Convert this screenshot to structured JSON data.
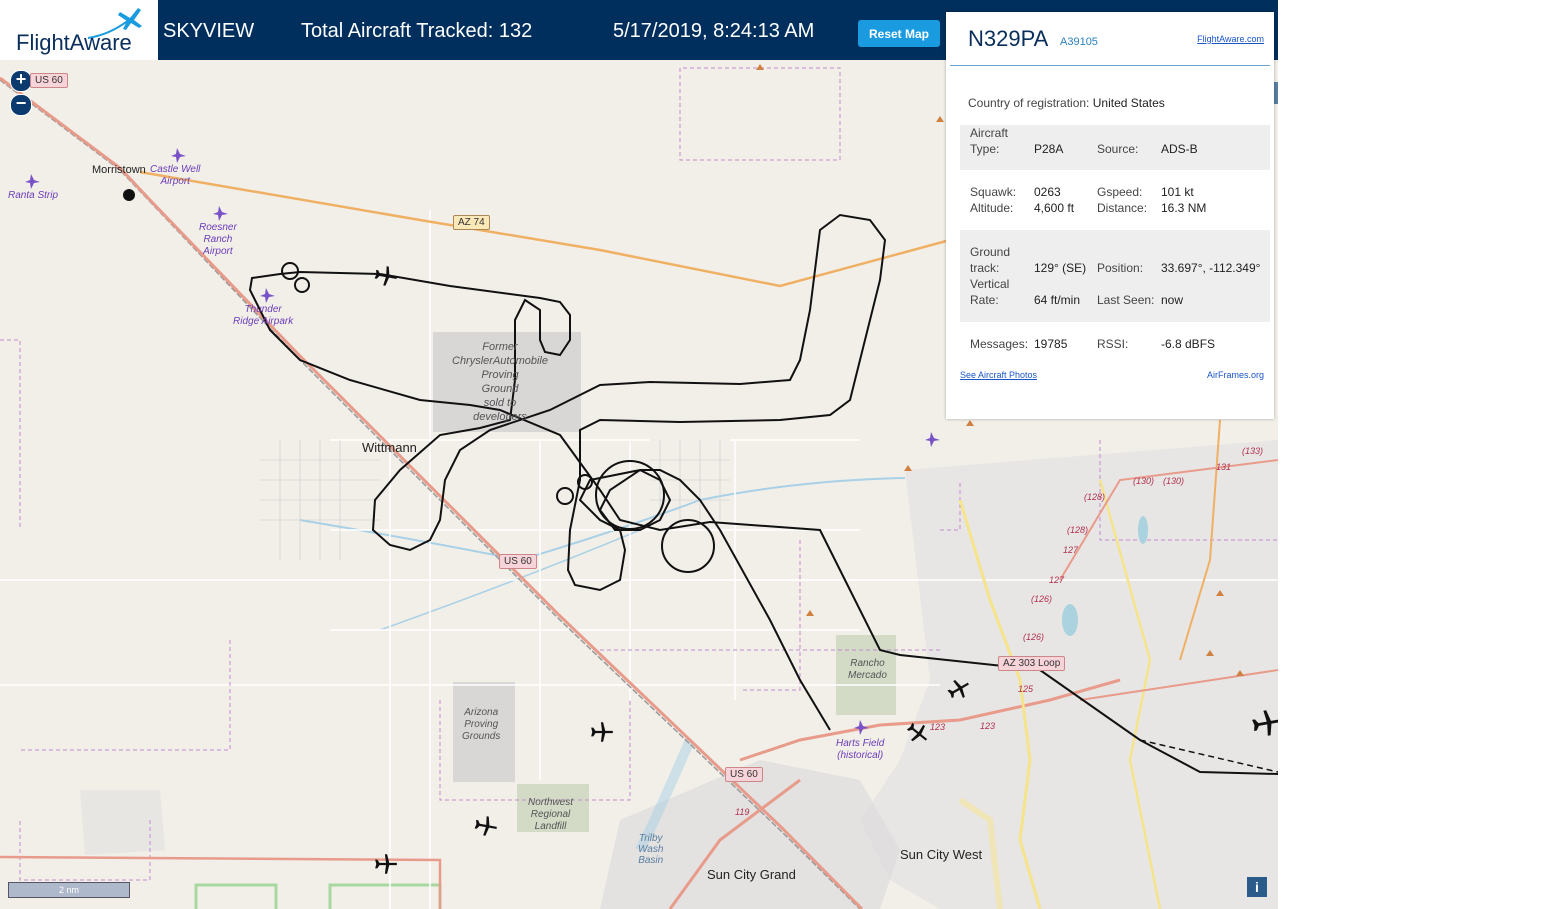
{
  "header": {
    "logo": "FlightAware",
    "title": "SKYVIEW",
    "total_tracked": "Total Aircraft Tracked: 132",
    "datetime": "5/17/2019, 8:24:13 AM",
    "reset_label": "Reset Map"
  },
  "map": {
    "zoom_in": "+",
    "zoom_out": "−",
    "scale": "2 nm",
    "info": "i",
    "labels": {
      "morristown": "Morristown",
      "wittmann": "Wittmann",
      "sun_city_west": "Sun City West",
      "sun_city_grand": "Sun City Grand",
      "ranta": "Ranta Strip",
      "castle_well": "Castle Well\nAirport",
      "roesner": "Roesner\nRanch\nAirport",
      "thunder": "Thunder\nRidge Airpark",
      "harts": "Harts Field\n(historical)",
      "chrysler": "Former\nChryslerAutomobile\nProving\nGround\nsold to\ndevelopers",
      "az_proving": "Arizona\nProving\nGrounds",
      "landfill": "Northwest\nRegional\nLandfill",
      "trilby": "Trilby\nWash\nBasin",
      "rancho": "Rancho\nMercado"
    },
    "shields": {
      "us60_top": "US 60",
      "az74": "AZ 74",
      "us60_mid": "US 60",
      "us60_low": "US 60",
      "az303": "AZ 303 Loop"
    },
    "route_numbers": [
      "(133)",
      "131",
      "(130)",
      "(130)",
      "(128)",
      "(128)",
      "127",
      "127",
      "(126)",
      "(126)",
      "125",
      "123",
      "123",
      "119"
    ]
  },
  "panel": {
    "registration": "N329PA",
    "hex": "A39105",
    "fa_link": "FlightAware.com",
    "country_label": "Country of registration:",
    "country_value": "United States",
    "aircraft_type_label": "Aircraft\nType:",
    "aircraft_type": "P28A",
    "source_label": "Source:",
    "source": "ADS-B",
    "squawk_label": "Squawk:",
    "squawk": "0263",
    "altitude_label": "Altitude:",
    "altitude": "4,600 ft",
    "gspeed_label": "Gspeed:",
    "gspeed": "101 kt",
    "distance_label": "Distance:",
    "distance": "16.3 NM",
    "track_label": "Ground\ntrack:",
    "track": "129° (SE)",
    "position_label": "Position:",
    "position": "33.697°, -112.349°",
    "vrate_label": "Vertical\nRate:",
    "vrate": "64 ft/min",
    "lastseen_label": "Last Seen:",
    "lastseen": "now",
    "messages_label": "Messages:",
    "messages": "19785",
    "rssi_label": "RSSI:",
    "rssi": "-6.8 dBFS",
    "photos_link": "See Aircraft Photos",
    "airframes_link": "AirFrames.org"
  }
}
